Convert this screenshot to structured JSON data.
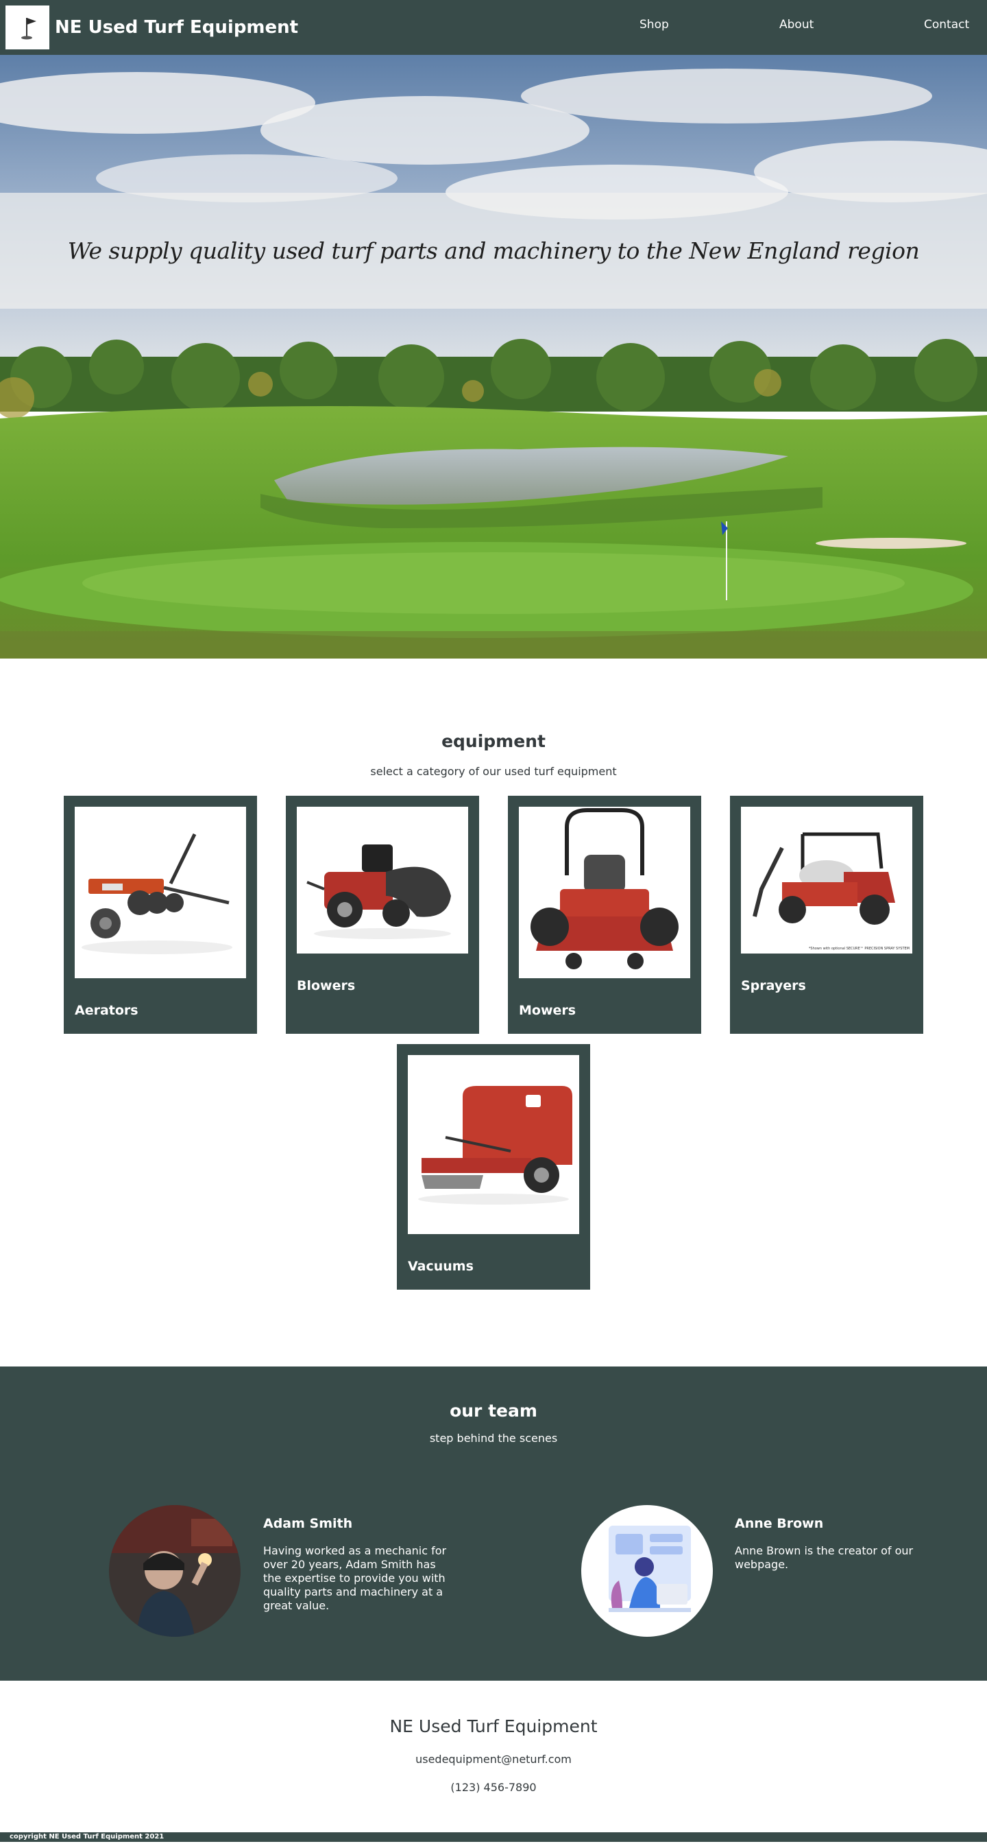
{
  "header": {
    "brand": "NE Used Turf Equipment",
    "logo_icon": "golf-flag-icon",
    "nav": {
      "shop": "Shop",
      "about": "About",
      "contact": "Contact"
    }
  },
  "hero": {
    "tagline": "We supply quality used turf parts and machinery to the New England region"
  },
  "equipment": {
    "title": "equipment",
    "subtitle": "select a category of our used turf equipment",
    "categories": [
      {
        "label": "Aerators",
        "icon": "aerator-image"
      },
      {
        "label": "Blowers",
        "icon": "blower-image"
      },
      {
        "label": "Mowers",
        "icon": "mower-image"
      },
      {
        "label": "Sprayers",
        "icon": "sprayer-image",
        "caption": "*Shown with optional SECURE™ PRECISION SPRAY SYSTEM"
      },
      {
        "label": "Vacuums",
        "icon": "vacuum-image"
      }
    ]
  },
  "team": {
    "title": "our team",
    "subtitle": "step behind the scenes",
    "members": [
      {
        "name": "Adam Smith",
        "bio": "Having worked as a mechanic for over 20 years, Adam Smith has the expertise to provide you with quality parts and machinery at a great value."
      },
      {
        "name": "Anne Brown",
        "bio": "Anne Brown is the creator of our webpage."
      }
    ]
  },
  "footer": {
    "company": "NE Used Turf Equipment",
    "email": "usedequipment@neturf.com",
    "phone": "(123) 456-7890",
    "copyright": "copyright NE Used Turf Equipment 2021"
  },
  "colors": {
    "primary": "#384b49",
    "text": "#33393c",
    "accent_red": "#b83a2a"
  }
}
